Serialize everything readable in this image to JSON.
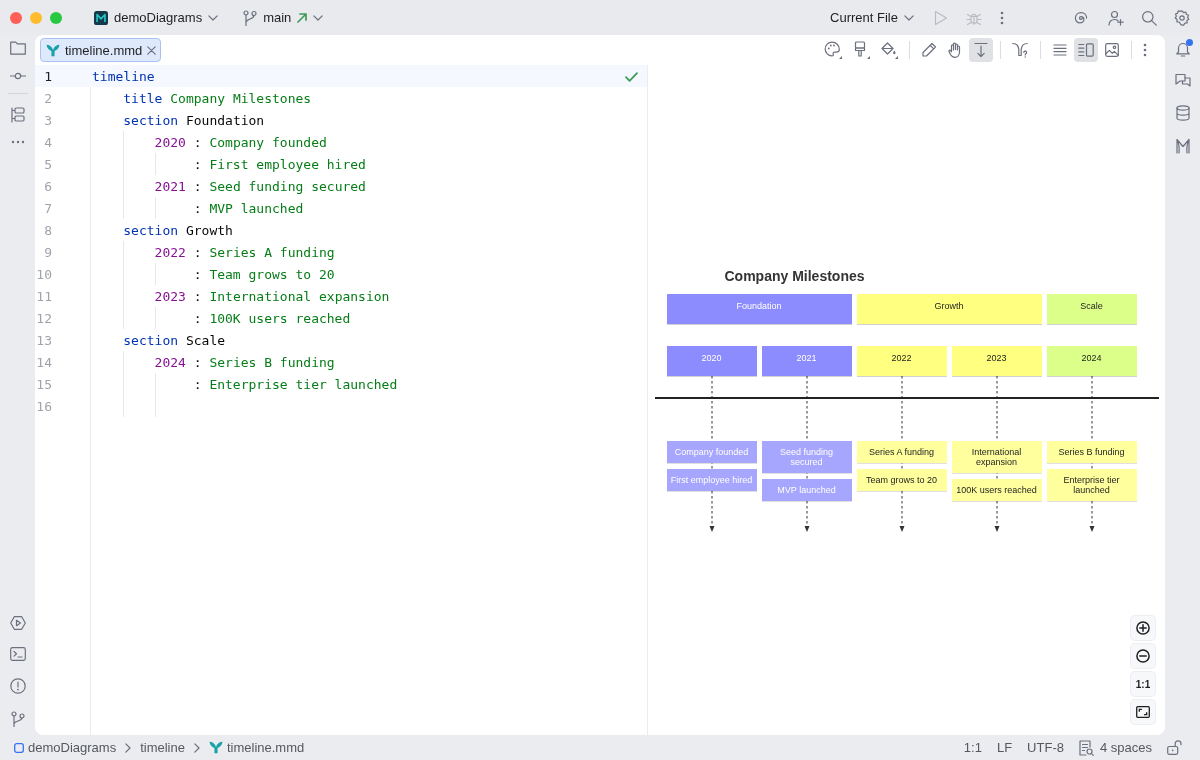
{
  "title_bar": {
    "project": "demoDiagrams",
    "branch": "main",
    "outgoing_changes": true,
    "run_config": "Current File",
    "run_disabled": true,
    "debug_disabled": true
  },
  "notifications": {
    "unread": true
  },
  "tabs": [
    {
      "label": "timeline.mmd",
      "selected": true
    }
  ],
  "editor_toolbar": {
    "scroll_toggle_on": true,
    "view_modes": [
      {
        "kind": "editor",
        "selected": false
      },
      {
        "kind": "split",
        "selected": true
      },
      {
        "kind": "preview",
        "selected": false
      }
    ]
  },
  "editor": {
    "no_problems": true,
    "lines": [
      {
        "number": "1",
        "current": true,
        "tokens": [
          {
            "kind": "keyword",
            "text": "timeline"
          }
        ]
      },
      {
        "number": "2",
        "current": false,
        "tokens": [
          {
            "kind": "keyword",
            "text": "    title"
          },
          {
            "kind": "string",
            "text": " Company Milestones"
          }
        ]
      },
      {
        "number": "3",
        "current": false,
        "tokens": [
          {
            "kind": "keyword",
            "text": "    section"
          },
          {
            "kind": "plain",
            "text": " Foundation"
          }
        ]
      },
      {
        "number": "4",
        "current": false,
        "tokens": [
          {
            "kind": "number",
            "text": "        2020"
          },
          {
            "kind": "plain",
            "text": " : "
          },
          {
            "kind": "string",
            "text": "Company founded"
          }
        ]
      },
      {
        "number": "5",
        "current": false,
        "tokens": [
          {
            "kind": "plain",
            "text": "             : "
          },
          {
            "kind": "string",
            "text": "First employee hired"
          }
        ]
      },
      {
        "number": "6",
        "current": false,
        "tokens": [
          {
            "kind": "number",
            "text": "        2021"
          },
          {
            "kind": "plain",
            "text": " : "
          },
          {
            "kind": "string",
            "text": "Seed funding secured"
          }
        ]
      },
      {
        "number": "7",
        "current": false,
        "tokens": [
          {
            "kind": "plain",
            "text": "             : "
          },
          {
            "kind": "string",
            "text": "MVP launched"
          }
        ]
      },
      {
        "number": "8",
        "current": false,
        "tokens": [
          {
            "kind": "keyword",
            "text": "    section"
          },
          {
            "kind": "plain",
            "text": " Growth"
          }
        ]
      },
      {
        "number": "9",
        "current": false,
        "tokens": [
          {
            "kind": "number",
            "text": "        2022"
          },
          {
            "kind": "plain",
            "text": " : "
          },
          {
            "kind": "string",
            "text": "Series A funding"
          }
        ]
      },
      {
        "number": "10",
        "current": false,
        "tokens": [
          {
            "kind": "plain",
            "text": "             : "
          },
          {
            "kind": "string",
            "text": "Team grows to 20"
          }
        ]
      },
      {
        "number": "11",
        "current": false,
        "tokens": [
          {
            "kind": "number",
            "text": "        2023"
          },
          {
            "kind": "plain",
            "text": " : "
          },
          {
            "kind": "string",
            "text": "International expansion"
          }
        ]
      },
      {
        "number": "12",
        "current": false,
        "tokens": [
          {
            "kind": "plain",
            "text": "             : "
          },
          {
            "kind": "string",
            "text": "100K users reached"
          }
        ]
      },
      {
        "number": "13",
        "current": false,
        "tokens": [
          {
            "kind": "keyword",
            "text": "    section"
          },
          {
            "kind": "plain",
            "text": " Scale"
          }
        ]
      },
      {
        "number": "14",
        "current": false,
        "tokens": [
          {
            "kind": "number",
            "text": "        2024"
          },
          {
            "kind": "plain",
            "text": " : "
          },
          {
            "kind": "string",
            "text": "Series B funding"
          }
        ]
      },
      {
        "number": "15",
        "current": false,
        "tokens": [
          {
            "kind": "plain",
            "text": "             : "
          },
          {
            "kind": "string",
            "text": "Enterprise tier launched"
          }
        ]
      },
      {
        "number": "16",
        "current": false
      }
    ]
  },
  "preview": {
    "title": "Company Milestones",
    "sections": [
      {
        "name": "Foundation",
        "color": "#8c8cff",
        "periods": [
          {
            "year": "2020",
            "events": [
              {
                "text": "Company founded",
                "color": "#a6a6ff"
              },
              {
                "text": "First employee hired",
                "color": "#a6a6ff"
              }
            ]
          },
          {
            "year": "2021",
            "events": [
              {
                "text": "Seed funding secured",
                "color": "#a6a6ff"
              },
              {
                "text": "MVP launched",
                "color": "#a6a6ff"
              }
            ]
          }
        ]
      },
      {
        "name": "Growth",
        "color": "#ffff80",
        "periods": [
          {
            "year": "2022",
            "events": [
              {
                "text": "Series A funding",
                "color": "#ffff9e"
              },
              {
                "text": "Team grows to 20",
                "color": "#ffff9e"
              }
            ]
          },
          {
            "year": "2023",
            "events": [
              {
                "text": "International expansion",
                "color": "#ffff9e"
              },
              {
                "text": "100K users reached",
                "color": "#ffff9e"
              }
            ]
          }
        ]
      },
      {
        "name": "Scale",
        "color": "#dbff88",
        "periods": [
          {
            "year": "2024",
            "events": [
              {
                "text": "Series B funding",
                "color": "#ffff9e"
              },
              {
                "text": "Enterprise tier launched",
                "color": "#ffff9e"
              }
            ]
          }
        ]
      }
    ],
    "zoom_controls": [
      {
        "kind": "zoom_in"
      },
      {
        "kind": "zoom_out"
      },
      {
        "kind": "actual_size",
        "label": "1:1"
      },
      {
        "kind": "fit"
      }
    ]
  },
  "status_bar": {
    "breadcrumbs": [
      {
        "kind": "project",
        "label": "demoDiagrams"
      },
      {
        "kind": "folder",
        "label": "timeline"
      },
      {
        "kind": "file",
        "label": "timeline.mmd"
      }
    ],
    "caret_position": "1:1",
    "line_separator": "LF",
    "encoding": "UTF-8",
    "indent": "4 spaces",
    "read_only": false
  }
}
